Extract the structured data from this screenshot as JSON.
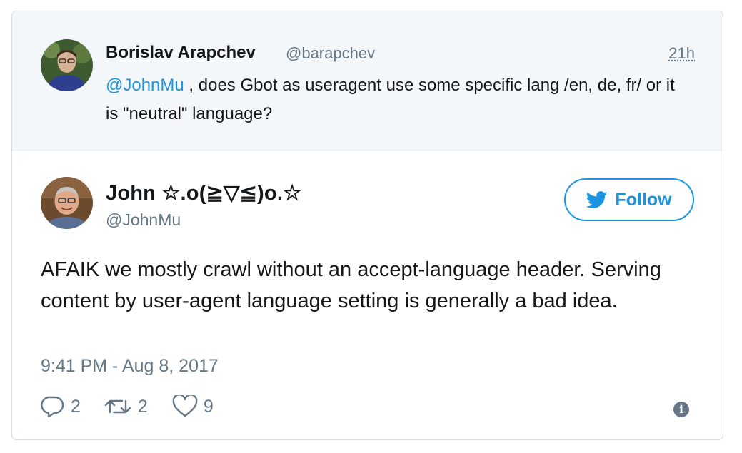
{
  "parent_tweet": {
    "author_name": "Borislav Arapchev",
    "author_handle": "@barapchev",
    "time": "21h",
    "mention": "@JohnMu",
    "text": " , does Gbot as useragent use some specific lang /en, de, fr/ or it is \"neutral\" language?",
    "avatar_icon": "user-avatar"
  },
  "main_tweet": {
    "author_name": "John ☆.o(≧▽≦)o.☆",
    "author_handle": "@JohnMu",
    "follow_label": "Follow",
    "text": "AFAIK we mostly crawl without an accept-language header. Serving content by user-agent language setting is generally a bad idea.",
    "timestamp": "9:41 PM - Aug 8, 2017",
    "reply_count": "2",
    "retweet_count": "2",
    "like_count": "9",
    "avatar_icon": "user-avatar"
  },
  "colors": {
    "accent": "#1b95e0",
    "muted": "#657786",
    "parent_bg": "#f4f7f9"
  }
}
